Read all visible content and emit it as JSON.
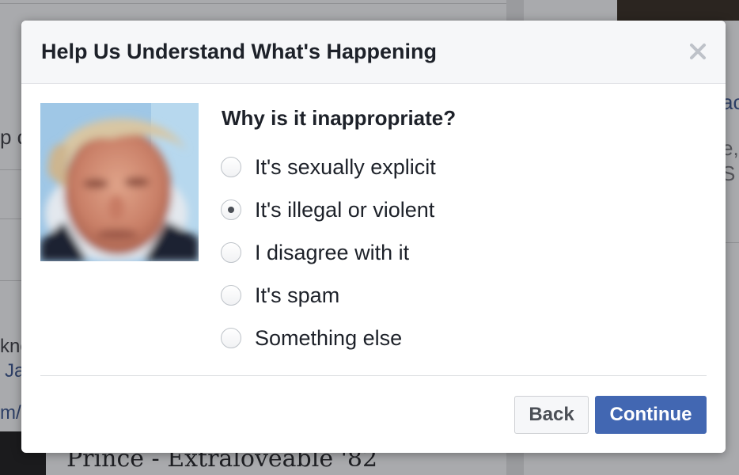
{
  "background": {
    "left_fragment": "p c",
    "right_fragment_1": "ac",
    "right_fragment_2": "e,",
    "right_fragment_3": "S",
    "left_fragment_2": "kno",
    "left_link_1": "Ja",
    "left_link_2": "m/",
    "post_title": "Prince - Extraloveable '82"
  },
  "dialog": {
    "title": "Help Us Understand What's Happening",
    "close_icon": "close-icon",
    "question": "Why is it inappropriate?",
    "options": [
      {
        "label": "It's sexually explicit",
        "checked": false
      },
      {
        "label": "It's illegal or violent",
        "checked": true
      },
      {
        "label": "I disagree with it",
        "checked": false
      },
      {
        "label": "It's spam",
        "checked": false
      },
      {
        "label": "Something else",
        "checked": false
      }
    ],
    "back_label": "Back",
    "continue_label": "Continue"
  },
  "colors": {
    "primary_button": "#4267b2",
    "header_bg": "#f6f7f9",
    "text": "#1d2129"
  }
}
